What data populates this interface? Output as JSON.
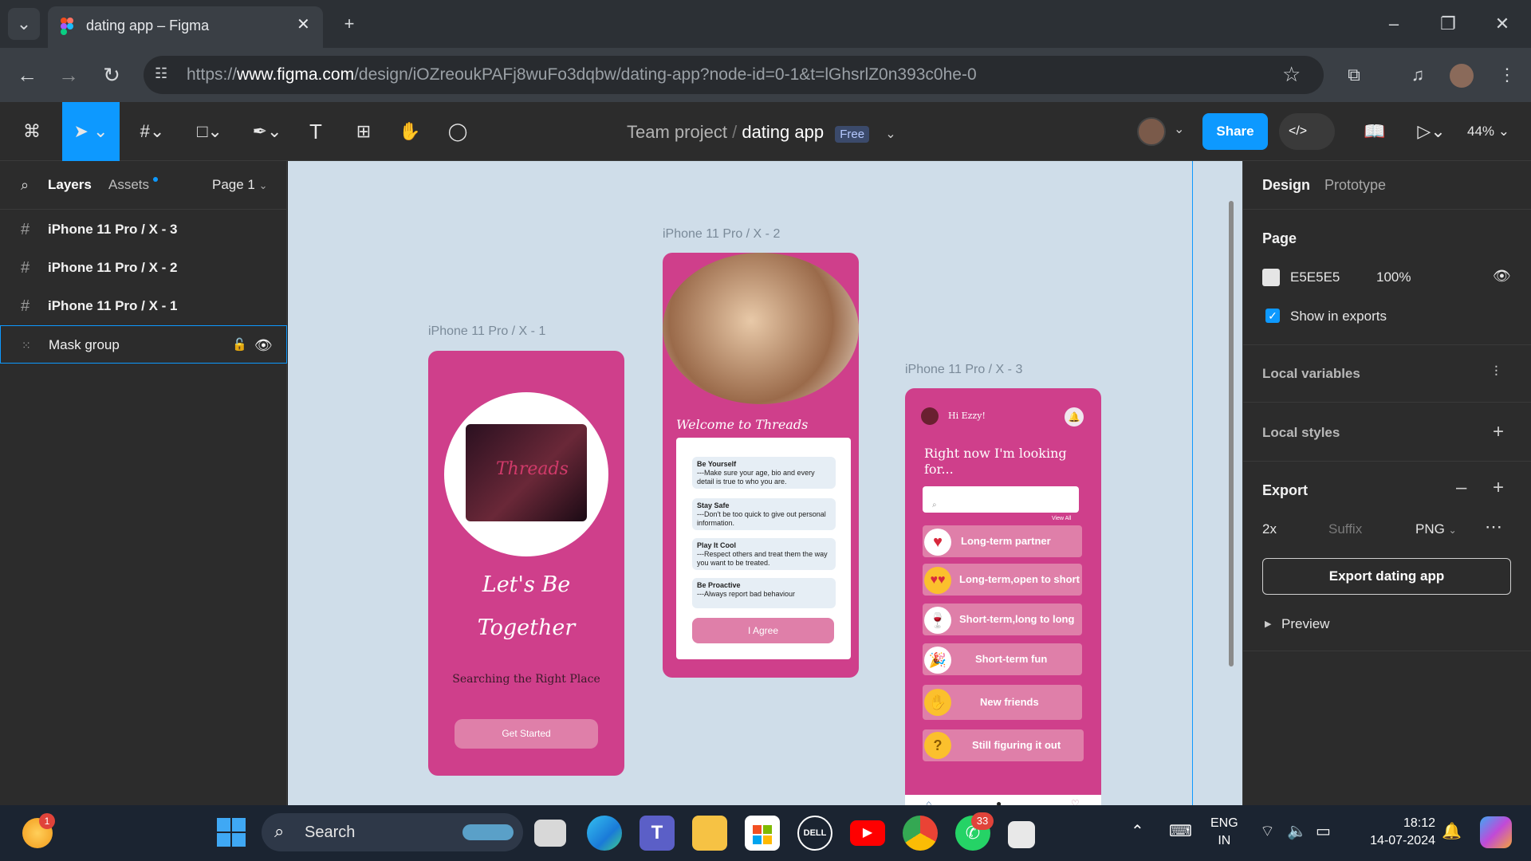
{
  "browser": {
    "tab_title": "dating app – Figma",
    "url_prefix": "https://",
    "url_host": "www.figma.com",
    "url_path": "/design/iOZreoukPAFj8wuFo3dqbw/dating-app?node-id=0-1&t=lGhsrlZ0n393c0he-0"
  },
  "toolbar": {
    "team": "Team project",
    "separator": "/",
    "file_name": "dating app",
    "plan_badge": "Free",
    "share_label": "Share",
    "zoom": "44%"
  },
  "left_panel": {
    "tab_layers": "Layers",
    "tab_assets": "Assets",
    "page_selector": "Page 1",
    "layers": [
      {
        "label": "iPhone 11 Pro / X - 3"
      },
      {
        "label": "iPhone 11 Pro / X - 2"
      },
      {
        "label": "iPhone 11 Pro / X - 1"
      },
      {
        "label": "Mask group"
      }
    ]
  },
  "canvas": {
    "frame1": {
      "label": "iPhone 11 Pro / X - 1",
      "logo_text": "Threads",
      "headline_1": "Let's Be",
      "headline_2": "Together",
      "subtitle": "Searching the Right Place",
      "button": "Get Started"
    },
    "frame2": {
      "label": "iPhone 11 Pro / X - 2",
      "welcome": "Welcome to Threads",
      "tips": [
        {
          "title": "Be Yourself",
          "body": "---Make sure your age, bio and every detail is true to who you are."
        },
        {
          "title": "Stay Safe",
          "body": "---Don't be too quick to give out personal information."
        },
        {
          "title": "Play It Cool",
          "body": "---Respect others and treat them the way you want to be treated."
        },
        {
          "title": "Be Proactive",
          "body": "---Always report bad behaviour"
        }
      ],
      "button": "I Agree"
    },
    "frame3": {
      "label": "iPhone 11 Pro / X - 3",
      "greeting": "Hi Ezzy!",
      "heading": "Right now I'm looking for...",
      "view_all": "View All",
      "options": [
        {
          "label": "Long-term partner",
          "icon": "heart-emoji-icon"
        },
        {
          "label": "Long-term,open to short",
          "icon": "heart-eyes-emoji-icon"
        },
        {
          "label": "Short-term,long to long",
          "icon": "wine-glass-emoji-icon"
        },
        {
          "label": "Short-term fun",
          "icon": "party-emoji-icon"
        },
        {
          "label": "New friends",
          "icon": "wave-emoji-icon"
        },
        {
          "label": "Still figuring it out",
          "icon": "thinking-emoji-icon"
        }
      ]
    }
  },
  "right_panel": {
    "tab_design": "Design",
    "tab_prototype": "Prototype",
    "page_heading": "Page",
    "page_color": "E5E5E5",
    "page_opacity": "100%",
    "show_in_exports": "Show in exports",
    "local_variables": "Local variables",
    "local_styles": "Local styles",
    "export_heading": "Export",
    "export_scale": "2x",
    "export_suffix_placeholder": "Suffix",
    "export_format": "PNG",
    "export_button": "Export dating app",
    "preview": "Preview"
  },
  "taskbar": {
    "search_placeholder": "Search",
    "weather_badge": "1",
    "whatsapp_badge": "33",
    "lang_1": "ENG",
    "lang_2": "IN",
    "time": "18:12",
    "date": "14-07-2024"
  },
  "colors": {
    "accent": "#0d99ff",
    "phone_pink": "#cf3f8b",
    "option_pink": "#df7fa9",
    "canvas_bg": "#cfdde9"
  }
}
